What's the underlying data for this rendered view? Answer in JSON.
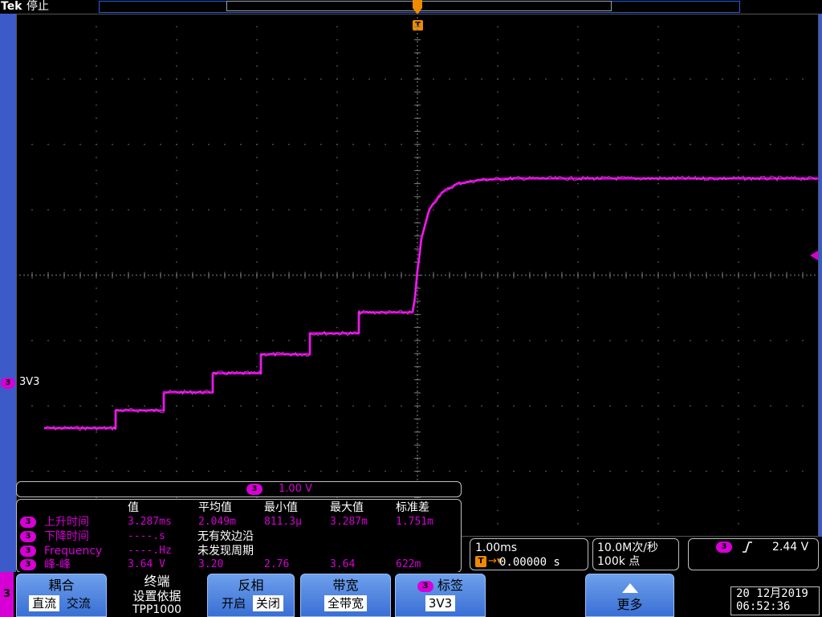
{
  "header": {
    "brand": "Tek",
    "run_state": "停止"
  },
  "trigger_marker": {
    "label": "T"
  },
  "channel": {
    "number": "3",
    "label": "3V3",
    "scale": "1.00 V",
    "color": "#d600d6"
  },
  "measurements": {
    "headers": {
      "value": "值",
      "mean": "平均值",
      "min": "最小值",
      "max": "最大值",
      "stddev": "标准差"
    },
    "rows": [
      {
        "name": "上升时间",
        "value": "3.287ms",
        "mean": "2.049m",
        "min": "811.3µ",
        "max": "3.287m",
        "stddev": "1.751m"
      },
      {
        "name": "下降时间",
        "value": "----.s",
        "message": "无有效边沿"
      },
      {
        "name": "Frequency",
        "value": "----.Hz",
        "message": "未发现周期"
      },
      {
        "name": "峰-峰",
        "value": "3.64 V",
        "mean": "3.20",
        "min": "2.76",
        "max": "3.64",
        "stddev": "622m"
      }
    ]
  },
  "horizontal": {
    "time_per_div": "1.00ms",
    "trigger_position": "0.00000 s"
  },
  "acquisition": {
    "sample_rate": "10.0M次/秒",
    "record_length": "100k 点"
  },
  "trigger": {
    "source": "3",
    "slope": "rising",
    "level": "2.44 V"
  },
  "menu": {
    "channel": "3",
    "coupling": {
      "title": "耦合",
      "options": [
        "直流",
        "交流"
      ],
      "selected": 0
    },
    "termination": {
      "title": "终端",
      "line2": "设置依据",
      "line3": "TPP1000"
    },
    "invert": {
      "title": "反相",
      "options": [
        "开启",
        "关闭"
      ],
      "selected": 1
    },
    "bandwidth": {
      "title": "带宽",
      "value": "全带宽"
    },
    "label": {
      "chip": "3",
      "title": "标签",
      "value": "3V3"
    },
    "more": {
      "title": "更多"
    }
  },
  "datetime": {
    "date": "20 12月2019",
    "time": "06:52:36"
  },
  "chart_data": {
    "type": "line",
    "title": "",
    "xlabel": "",
    "ylabel": "",
    "x_unit": "ms",
    "y_unit": "V",
    "xlim": [
      -5.0,
      5.0
    ],
    "ylim": [
      -1.66,
      6.34
    ],
    "series": [
      {
        "x": [
          -4.65,
          -3.76,
          -3.76,
          -3.16,
          -3.16,
          -2.55,
          -2.55,
          -1.95,
          -1.95,
          -1.34,
          -1.34,
          -0.73,
          -0.73,
          -0.06,
          -0.03,
          0.0,
          0.05,
          0.15,
          0.3,
          0.5,
          0.8,
          1.2,
          2.0,
          3.0,
          4.0,
          5.0
        ],
        "y": [
          0.0,
          0.0,
          0.27,
          0.27,
          0.55,
          0.55,
          0.84,
          0.84,
          1.13,
          1.13,
          1.45,
          1.45,
          1.77,
          1.77,
          2.0,
          2.4,
          2.9,
          3.35,
          3.6,
          3.74,
          3.8,
          3.82,
          3.82,
          3.82,
          3.82,
          3.82
        ]
      }
    ]
  }
}
